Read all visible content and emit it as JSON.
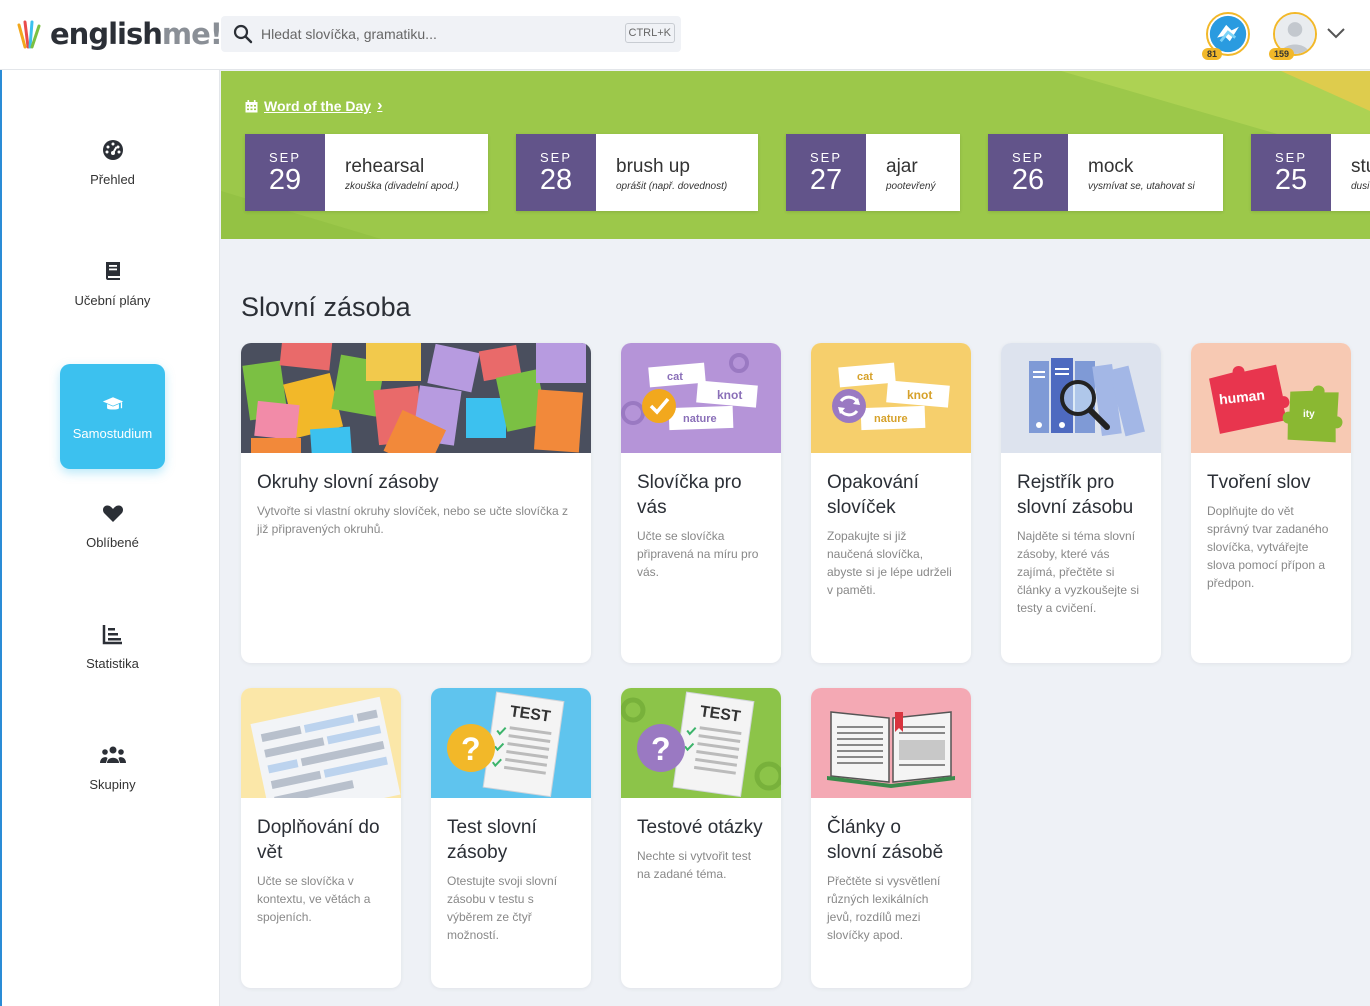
{
  "header": {
    "logo_main": "english",
    "logo_accent": "me!",
    "search_placeholder": "Hledat slovíčka, gramatiku...",
    "shortcut": "CTRL+K",
    "badge_points": "81",
    "avatar_points": "159"
  },
  "sidebar": {
    "items": [
      {
        "label": "Přehled",
        "icon": "dashboard-icon"
      },
      {
        "label": "Učební plány",
        "icon": "book-icon"
      },
      {
        "label": "Samostudium",
        "icon": "graduation-cap-icon"
      },
      {
        "label": "Oblíbené",
        "icon": "heart-icon"
      },
      {
        "label": "Statistika",
        "icon": "chart-icon"
      },
      {
        "label": "Skupiny",
        "icon": "users-icon"
      }
    ]
  },
  "word_of_day": {
    "title": "Word of the Day",
    "cards": [
      {
        "month": "SEP",
        "day": "29",
        "word": "rehearsal",
        "translation": "zkouška (divadelní apod.)"
      },
      {
        "month": "SEP",
        "day": "28",
        "word": "brush up",
        "translation": "oprášit (např. dovednost)"
      },
      {
        "month": "SEP",
        "day": "27",
        "word": "ajar",
        "translation": "pootevřený"
      },
      {
        "month": "SEP",
        "day": "26",
        "word": "mock",
        "translation": "vysmívat se, utahovat si"
      },
      {
        "month": "SEP",
        "day": "25",
        "word": "stu",
        "translation": "dusi"
      }
    ]
  },
  "section": {
    "title": "Slovní zásoba",
    "cards": [
      {
        "title": "Okruhy slovní zásoby",
        "desc": "Vytvořte si vlastní okruhy slovíček, nebo se učte slovíčka z již připravených okruhů."
      },
      {
        "title": "Slovíčka pro vás",
        "desc": "Učte se slovíčka připravená na míru pro vás."
      },
      {
        "title": "Opakování slovíček",
        "desc": "Zopakujte si již naučená slovíčka, abyste si je lépe udrželi v paměti."
      },
      {
        "title": "Rejstřík pro slovní zásobu",
        "desc": "Najděte si téma slovní zásoby, které vás zajímá, přečtěte si články a vyzkoušejte si testy a cvičení."
      },
      {
        "title": "Tvoření slov",
        "desc": "Doplňujte do vět správný tvar zadaného slovíčka, vytvářejte slova pomocí přípon a předpon."
      },
      {
        "title": "Doplňování do vět",
        "desc": "Učte se slovíčka v kontextu, ve větách a spojeních."
      },
      {
        "title": "Test slovní zásoby",
        "desc": "Otestujte svoji slovní zásobu v testu s výběrem ze čtyř možností."
      },
      {
        "title": "Testové otázky",
        "desc": "Nechte si vytvořit test na zadané téma."
      },
      {
        "title": "Články o slovní zásobě",
        "desc": "Přečtěte si vysvětlení různých lexikálních jevů, rozdílů mezi slovíčky apod."
      }
    ],
    "image_labels": {
      "cat": "cat",
      "knot": "knot",
      "nature": "nature",
      "human": "human",
      "ity": "ity",
      "test": "TEST"
    }
  },
  "colors": {
    "accent": "#3cc1ef",
    "banner": "#9cc84a",
    "date_block": "#62548a",
    "badge": "#f2b829"
  }
}
